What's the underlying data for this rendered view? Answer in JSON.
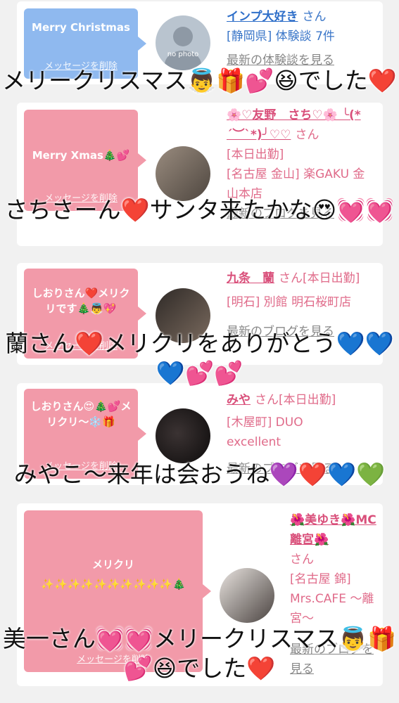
{
  "cards": [
    {
      "message": "Merry Christmas",
      "delete_label": "メッセージを削除",
      "avatar_text": "no photo",
      "name": "インプ大好き",
      "san": "さん",
      "details": [
        "[静岡県] 体験談 7件"
      ],
      "link": "最新の体験談を見る"
    },
    {
      "message": "Merry Xmas🎄💕",
      "delete_label": "メッセージを削除",
      "name": "🌸♡友野　さち♡🌸 ╰(*´︶`*)╯♡♡",
      "san": "さん",
      "details": [
        "[本日出勤]",
        "[名古屋 金山] 楽GAKU 金山本店"
      ],
      "link": "最新のブログを見る"
    },
    {
      "message": "しおりさん❤️メリクリです🎄👼💖",
      "delete_label": "メッセージを削除",
      "name": "九条　蘭",
      "san": "さん[本日出勤]",
      "details": [
        "[明石] 別館 明石桜町店"
      ],
      "link": "最新のブログを見る"
    },
    {
      "message": "しおりさん😍🎄💕メリクリ〜❄️🎁",
      "delete_label": "メッセージを削除",
      "name": "みや",
      "san": "さん[本日出勤]",
      "details": [
        "[木屋町] DUO excellent"
      ],
      "link": "最新のブログを見る"
    },
    {
      "message": "メリクリ",
      "message2": "✨✨✨✨✨✨✨✨✨✨🎄",
      "delete_label": "メッセージを削除",
      "name": "🌺美ゆき🌺MC離宮🌺",
      "san": "さん",
      "details": [
        "[名古屋 錦] Mrs.CAFE 〜離宮〜"
      ],
      "link": "最新のブログを見る"
    }
  ],
  "captions": [
    "メリークリスマス👼🎁💕😆でした❤️",
    "さちさーん❤️サンタ来たかな😍💓💓",
    "蘭さん❤️メリクリをありがとう💙💙💙💕💕",
    "みやこ〜来年は会おうね💜❤️💙💚",
    "美一さん💓💓メリークリスマス👼🎁💕😆でした❤️"
  ]
}
